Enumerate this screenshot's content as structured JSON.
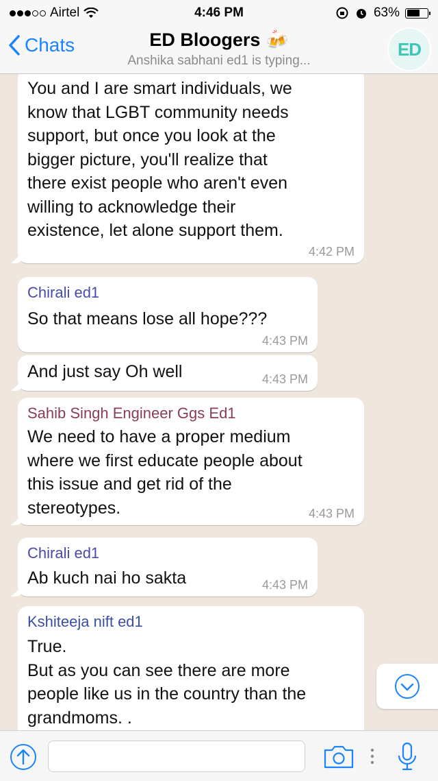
{
  "status_bar": {
    "carrier": "Airtel",
    "time": "4:46 PM",
    "battery": "63%",
    "battery_level": 0.63
  },
  "header": {
    "back_label": "Chats",
    "title": "ED Bloogers 🍻",
    "subtitle": "Anshika sabhani ed1 is typing...",
    "avatar_text": "ED"
  },
  "messages": [
    {
      "sender": "",
      "lines": [
        "You and I are smart individuals, we",
        "know that LGBT community needs",
        "support, but once you look at the",
        "bigger picture, you'll realize that",
        "there exist people who aren't even",
        "willing to acknowledge their",
        "existence, let alone support them."
      ],
      "time": "4:42 PM"
    },
    {
      "sender": "Chirali ed1",
      "sender_color": "#4a4aa8",
      "lines": [
        "So that means lose all hope???"
      ],
      "time": "4:43 PM"
    },
    {
      "sender": "",
      "lines": [
        "And just say Oh well"
      ],
      "time": "4:43 PM"
    },
    {
      "sender": "Sahib Singh Engineer Ggs Ed1",
      "sender_color": "#8a3b5a",
      "lines": [
        "We need to have a proper medium",
        "where we first educate people about",
        "this issue and get rid of the",
        "stereotypes."
      ],
      "time": "4:43 PM"
    },
    {
      "sender": "Chirali ed1",
      "sender_color": "#4a4aa8",
      "lines": [
        "Ab kuch  nai ho sakta"
      ],
      "time": "4:43 PM"
    },
    {
      "sender": "Kshiteeja nift ed1",
      "sender_color": "#3a4fa0",
      "lines": [
        "True.",
        "But as you can see there are more",
        "people like us in the country than the",
        "grandmoms. ."
      ],
      "time": ""
    }
  ],
  "colors": {
    "accent": "#1a83ff",
    "chat_bg": "#efe7dd",
    "bubble": "#ffffff"
  }
}
